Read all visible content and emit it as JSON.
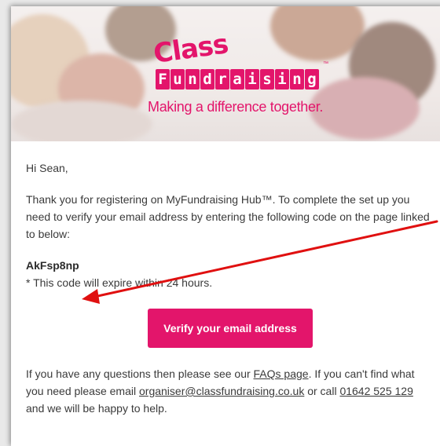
{
  "logo": {
    "word_class": "Class",
    "word_fundraising_letters": [
      "F",
      "u",
      "n",
      "d",
      "r",
      "a",
      "i",
      "s",
      "i",
      "n",
      "g"
    ],
    "tm": "™",
    "tagline": "Making a difference together."
  },
  "email": {
    "greeting": "Hi Sean,",
    "intro": "Thank you for registering on MyFundraising Hub™. To complete the set up you need to verify your email address by entering the following code on the page linked to below:",
    "code": "AkFsp8np",
    "code_note": "* This code will expire within 24 hours.",
    "button_label": "Verify your email address",
    "footer_prefix": "If you have any questions then please see our ",
    "faqs_link": "FAQs page",
    "footer_mid1": ". If you can't find what you need please email ",
    "email_link": "organiser@classfundraising.co.uk",
    "footer_mid2": " or call ",
    "phone_link": "01642 525 129",
    "footer_suffix": " and we will be happy to help."
  },
  "colors": {
    "brand_pink": "#e3156b",
    "annotation_arrow": "#e01010"
  }
}
